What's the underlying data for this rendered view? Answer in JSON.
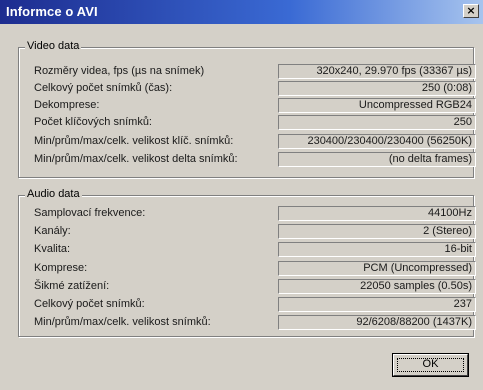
{
  "window": {
    "title": "Informce o AVI",
    "close_glyph": "×"
  },
  "video": {
    "legend": "Video data",
    "rows": [
      {
        "label": "Rozměry videa, fps (µs na snímek)",
        "value": "320x240, 29.970 fps (33367 µs)"
      },
      {
        "label": "Celkový počet snímků (čas):",
        "value": "250 (0:08)"
      },
      {
        "label": "Dekomprese:",
        "value": "Uncompressed RGB24"
      },
      {
        "label": "Počet klíčových snímků:",
        "value": "250"
      },
      {
        "label": "Min/prům/max/celk. velikost klíč. snímků:",
        "value": "230400/230400/230400 (56250K)"
      },
      {
        "label": "Min/prům/max/celk. velikost delta snímků:",
        "value": "(no delta frames)"
      }
    ]
  },
  "audio": {
    "legend": "Audio data",
    "rows": [
      {
        "label": "Samplovací frekvence:",
        "value": "44100Hz"
      },
      {
        "label": "Kanály:",
        "value": "2 (Stereo)"
      },
      {
        "label": "Kvalita:",
        "value": "16-bit"
      },
      {
        "label": "Komprese:",
        "value": "PCM (Uncompressed)"
      },
      {
        "label": "Šikmé zatížení:",
        "value": "22050 samples (0.50s)"
      },
      {
        "label": "Celkový počet snímků:",
        "value": "237"
      },
      {
        "label": "Min/prům/max/celk. velikost snímků:",
        "value": "92/6208/88200 (1437K)"
      }
    ]
  },
  "ok_label": "OK",
  "colors": {
    "titlebar_start": "#1d2c8f",
    "titlebar_end": "#a7c4ee",
    "face": "#d4d0c8"
  }
}
